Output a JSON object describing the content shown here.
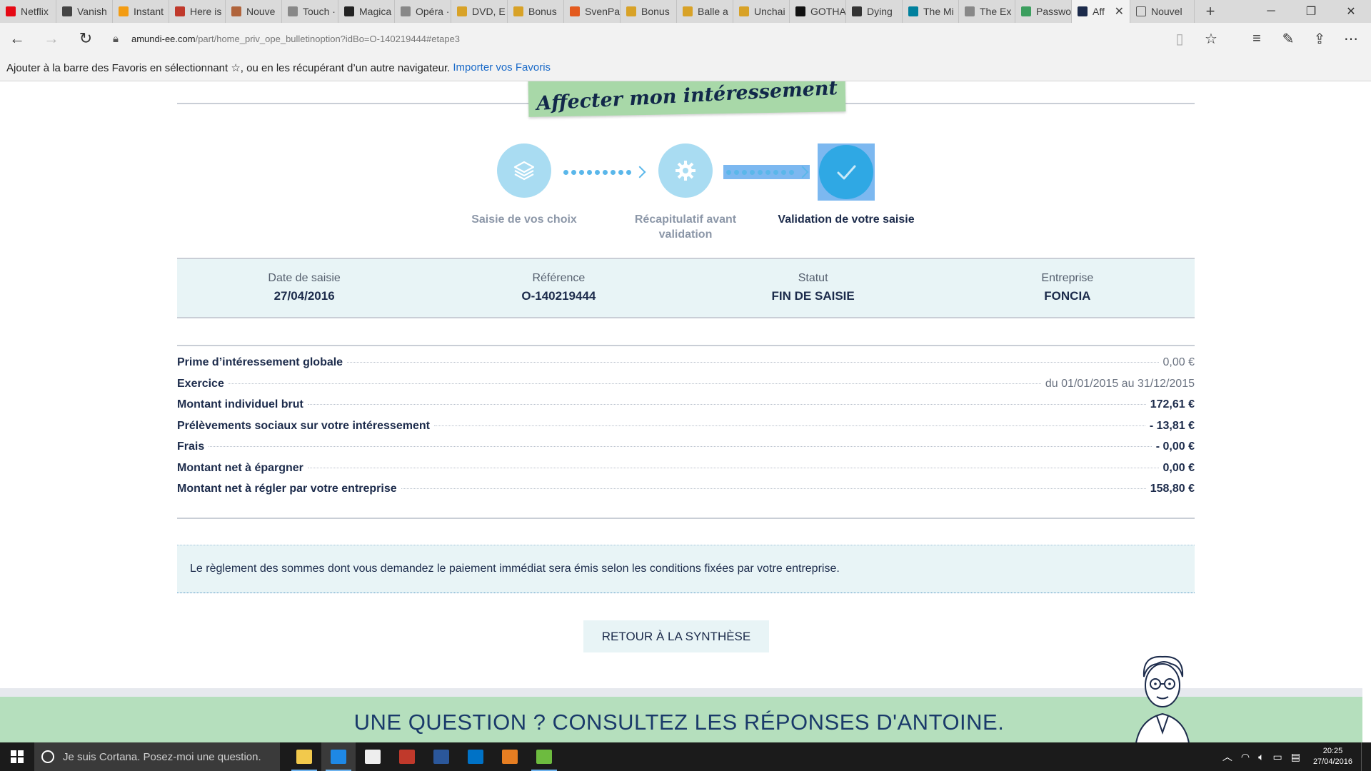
{
  "browser": {
    "tabs": [
      {
        "label": "Netflix",
        "icon": "netflix-icon",
        "color": "#e50914"
      },
      {
        "label": "Vanish",
        "icon": "gmail-icon",
        "color": "#444444"
      },
      {
        "label": "Instant",
        "icon": "star-icon",
        "color": "#f39c12"
      },
      {
        "label": "Here is",
        "icon": "reader-icon",
        "color": "#c0392b"
      },
      {
        "label": "Nouve",
        "icon": "m-icon",
        "color": "#b0643c"
      },
      {
        "label": "Touch ·",
        "icon": "page-icon",
        "color": "#888888"
      },
      {
        "label": "Magica",
        "icon": "magic-icon",
        "color": "#222222"
      },
      {
        "label": "Opéra ·",
        "icon": "page-icon",
        "color": "#888888"
      },
      {
        "label": "DVD, E",
        "icon": "free-icon",
        "color": "#d8a227"
      },
      {
        "label": "Bonus",
        "icon": "free-icon",
        "color": "#d8a227"
      },
      {
        "label": "SvenPa",
        "icon": "sven-icon",
        "color": "#e35a1e"
      },
      {
        "label": "Bonus",
        "icon": "free-icon",
        "color": "#d8a227"
      },
      {
        "label": "Balle a",
        "icon": "free-icon",
        "color": "#d8a227"
      },
      {
        "label": "Unchai",
        "icon": "free-icon",
        "color": "#d8a227"
      },
      {
        "label": "GOTHA",
        "icon": "gotha-icon",
        "color": "#111111"
      },
      {
        "label": "Dying",
        "icon": "amazon-icon",
        "color": "#333333"
      },
      {
        "label": "The Mi",
        "icon": "bing-icon",
        "color": "#00809d"
      },
      {
        "label": "The Ex",
        "icon": "page-icon",
        "color": "#888888"
      },
      {
        "label": "Passwo",
        "icon": "pass-icon",
        "color": "#3b9e5e"
      }
    ],
    "active_tab": {
      "label": "Aff",
      "icon": "amundi-icon",
      "color": "#1c2b4b"
    },
    "extra_tab": {
      "label": "Nouvel",
      "icon": "page-icon"
    },
    "url_host": "amundi-ee.com",
    "url_path": "/part/home_priv_ope_bulletinoption?idBo=O-140219444#etape3",
    "favorites_hint": "Ajouter à la barre des Favoris en sélectionnant ☆, ou en les récupérant d’un autre navigateur.",
    "favorites_link": "Importer vos Favoris"
  },
  "page": {
    "banner_title": "Affecter mon intéressement",
    "steps": [
      {
        "label": "Saisie de vos choix",
        "icon": "layers-icon",
        "state": "done"
      },
      {
        "label": "Récapitulatif avant validation",
        "icon": "gear-icon",
        "state": "done"
      },
      {
        "label": "Validation de votre saisie",
        "icon": "check-icon",
        "state": "current"
      }
    ],
    "summary": [
      {
        "label": "Date de saisie",
        "value": "27/04/2016"
      },
      {
        "label": "Référence",
        "value": "O-140219444"
      },
      {
        "label": "Statut",
        "value": "FIN DE SAISIE"
      },
      {
        "label": "Entreprise",
        "value": "FONCIA"
      }
    ],
    "details": [
      {
        "label": "Prime d’intéressement globale",
        "value": "0,00 €"
      },
      {
        "label": "Exercice",
        "value": "du 01/01/2015 au 31/12/2015"
      },
      {
        "label": "Montant individuel brut",
        "value": "172,61 €"
      },
      {
        "label": "Prélèvements sociaux sur votre intéressement",
        "value": "- 13,81 €"
      },
      {
        "label": "Frais",
        "value": "- 0,00 €"
      },
      {
        "label": "Montant net à épargner",
        "value": "0,00 €"
      },
      {
        "label": "Montant net à régler par votre entreprise",
        "value": "158,80 €"
      }
    ],
    "notice": "Le règlement des sommes dont vous demandez le paiement immédiat sera émis selon les conditions fixées par votre entreprise.",
    "back_button": "RETOUR À LA SYNTHÈSE",
    "footer_text": "UNE QUESTION ? CONSULTEZ LES RÉPONSES D'ANTOINE.",
    "colors": {
      "navy": "#1c2b4b",
      "step_light": "#a9dcf2",
      "step_done": "#2fa8e4",
      "banner": "#a8d8a8",
      "footer": "#b5dfbd",
      "panel": "#e8f4f6"
    }
  },
  "taskbar": {
    "cortana_placeholder": "Je suis Cortana. Posez-moi une question.",
    "apps": [
      {
        "name": "file-explorer-icon",
        "color": "#f2c94c"
      },
      {
        "name": "edge-icon",
        "color": "#1e88e5"
      },
      {
        "name": "store-icon",
        "color": "#eeeeee"
      },
      {
        "name": "red-app-icon",
        "color": "#c0392b"
      },
      {
        "name": "word-icon",
        "color": "#2b579a"
      },
      {
        "name": "outlook-icon",
        "color": "#0072c6"
      },
      {
        "name": "slides-icon",
        "color": "#e67e22"
      },
      {
        "name": "utorrent-icon",
        "color": "#6dbb3f"
      }
    ],
    "time": "20:25",
    "date": "27/04/2016"
  }
}
